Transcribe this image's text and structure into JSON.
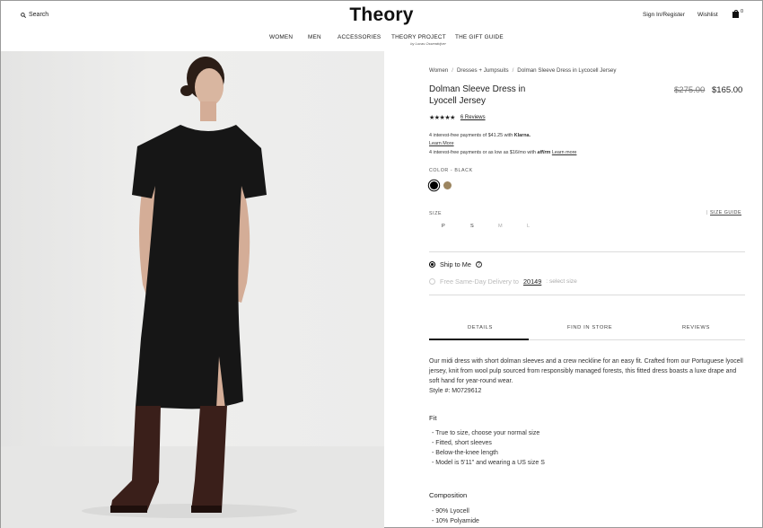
{
  "header": {
    "search_label": "Search",
    "logo": "Theory",
    "signin_label": "Sign In/Register",
    "wishlist_label": "Wishlist",
    "bag_count": "0"
  },
  "nav": {
    "items": [
      "WOMEN",
      "MEN",
      "ACCESSORIES",
      "THEORY PROJECT",
      "THE GIFT GUIDE"
    ],
    "theory_project_sub": "by Lucas Ossendrijver"
  },
  "breadcrumb": [
    "Women",
    "Dresses + Jumpsuits",
    "Dolman Sleeve Dress in Lycocell Jersey"
  ],
  "product": {
    "title": "Dolman Sleeve Dress in Lyocell Jersey",
    "price_original": "$275.00",
    "price_sale": "$165.00",
    "stars": "★★★★★",
    "rating_value": 4.5,
    "reviews_label": "6 Reviews"
  },
  "payments": {
    "klarna_text": "4 interest-free payments of $41.25 with",
    "klarna_brand": "Klarna.",
    "klarna_learn": "Learn More",
    "affirm_text": "4 interest-free payments or as low as $16/mo with",
    "affirm_brand": "affirm",
    "affirm_learn": "Learn more"
  },
  "color": {
    "label": "COLOR -",
    "selected": "BLACK",
    "swatches": [
      {
        "name": "Black",
        "hex": "#000000"
      },
      {
        "name": "Taupe",
        "hex": "#9c8560"
      }
    ]
  },
  "size": {
    "label": "SIZE",
    "guide_label": "SIZE GUIDE",
    "options": [
      "P",
      "S",
      "M",
      "L"
    ]
  },
  "delivery": {
    "ship_label": "Ship to Me",
    "pickup_label": "Free Same-Day Delivery to",
    "zip": "20149",
    "pickup_hint": ": select size"
  },
  "tabs": [
    "DETAILS",
    "FIND IN STORE",
    "REVIEWS"
  ],
  "details": {
    "description": "Our midi dress with short dolman sleeves and a crew neckline for an easy fit. Crafted from our Portuguese lyocell jersey, knit from wool pulp sourced from responsibly managed forests, this fitted dress boasts a luxe drape and soft hand for year-round wear.",
    "style": "Style #: M0729612",
    "fit_heading": "Fit",
    "fit_items": [
      "- True to size, choose your normal size",
      "- Fitted, short sleeves",
      "- Below-the-knee length",
      "- Model is 5'11\" and wearing a US size S"
    ],
    "composition_heading": "Composition",
    "composition_items": [
      "- 90% Lyocell",
      "- 10% Polyamide"
    ]
  }
}
